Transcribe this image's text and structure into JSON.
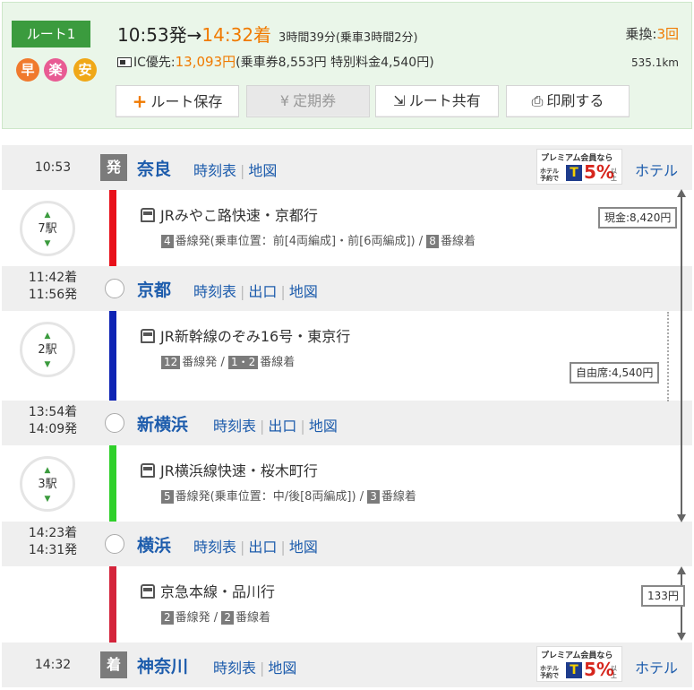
{
  "summary": {
    "route_label": "ルート1",
    "tags": [
      "早",
      "楽",
      "安"
    ],
    "depart_time": "10:53発",
    "arrow": "→",
    "arrive_time": "14:32着",
    "duration": "3時間39分(乗車3時間2分)",
    "fare_prefix": "IC優先:",
    "fare_total": "13,093円",
    "fare_breakdown": "(乗車券8,553円 特別料金4,540円)",
    "transfer_label": "乗換:",
    "transfer_count": "3回",
    "distance": "535.1km",
    "buttons": {
      "save": "ルート保存",
      "teiki": "定期券",
      "share": "ルート共有",
      "print": "印刷する"
    }
  },
  "stations": [
    {
      "time": "10:53",
      "badge": "発",
      "name": "奈良",
      "links": [
        "時刻表",
        "地図"
      ],
      "premium": true
    },
    {
      "time_arr": "11:42着",
      "time_dep": "11:56発",
      "name": "京都",
      "links": [
        "時刻表",
        "出口",
        "地図"
      ]
    },
    {
      "time_arr": "13:54着",
      "time_dep": "14:09発",
      "name": "新横浜",
      "links": [
        "時刻表",
        "出口",
        "地図"
      ]
    },
    {
      "time_arr": "14:23着",
      "time_dep": "14:31発",
      "name": "横浜",
      "links": [
        "時刻表",
        "出口",
        "地図"
      ]
    },
    {
      "time": "14:32",
      "badge": "着",
      "name": "神奈川",
      "links": [
        "時刻表",
        "地図"
      ],
      "premium": true
    }
  ],
  "premium_banner": {
    "line1": "プレミアム会員なら",
    "line2": "ホテル予約で",
    "logo": "T",
    "percent": "5%",
    "suffix": "以上",
    "hotel_link": "ホテル"
  },
  "segments": [
    {
      "stops": "7駅",
      "train": "JRみやこ路快速・京都行",
      "dep_num": "4",
      "dep_text": "番線発(乗車位置：前[4両編成]・前[6両編成])",
      "sep": "/",
      "arr_num": "8",
      "arr_text": "番線着",
      "line_color": "#e8101a"
    },
    {
      "stops": "2駅",
      "train": "JR新幹線のぞみ16号・東京行",
      "dep_num": "12",
      "dep_text": "番線発",
      "sep": "/",
      "arr_num": "1・2",
      "arr_text": "番線着",
      "line_color": "#0d23b4"
    },
    {
      "stops": "3駅",
      "train": "JR横浜線快速・桜木町行",
      "dep_num": "5",
      "dep_text": "番線発(乗車位置：中/後[8両編成])",
      "sep": "/",
      "arr_num": "3",
      "arr_text": "番線着",
      "line_color": "#2fd02a"
    },
    {
      "stops": "",
      "train": "京急本線・品川行",
      "dep_num": "2",
      "dep_text": "番線発",
      "sep": "/",
      "arr_num": "2",
      "arr_text": "番線着",
      "line_color": "#d4243b"
    }
  ],
  "fares": {
    "cash": "現金:8,420円",
    "reserved": "自由席:4,540円",
    "keikyu": "133円"
  }
}
